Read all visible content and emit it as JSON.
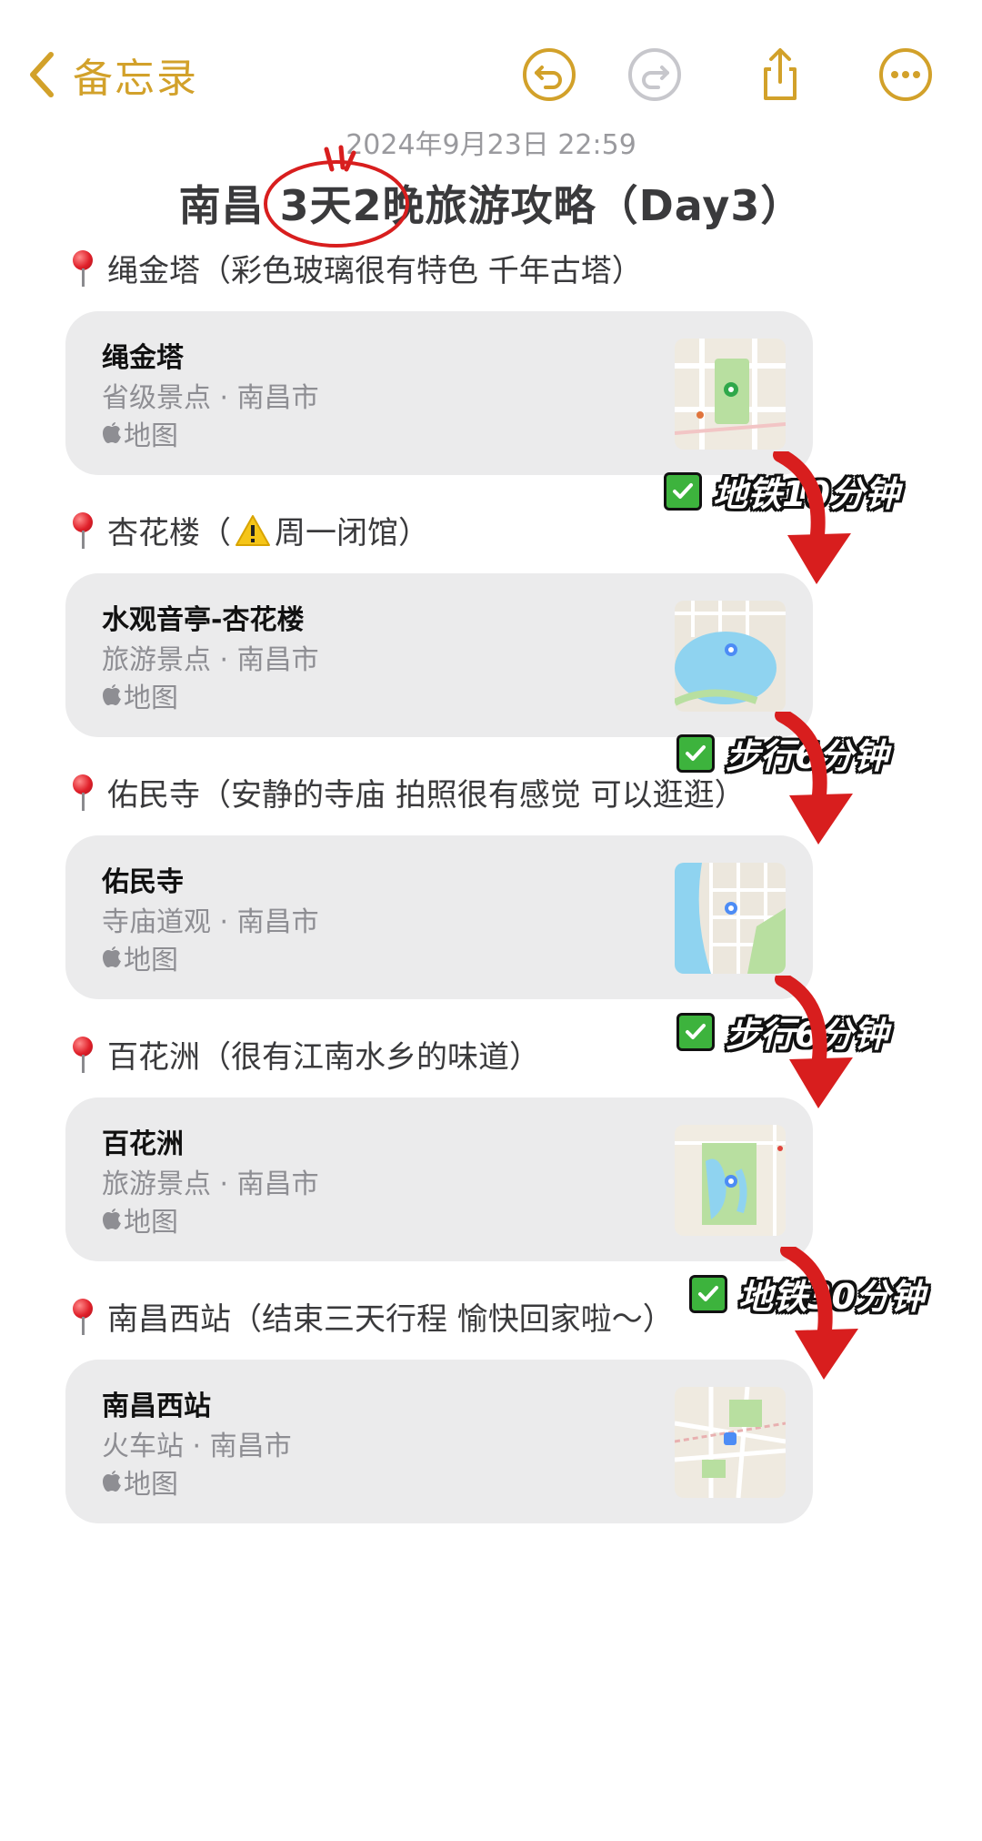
{
  "nav": {
    "back_label": "备忘录",
    "undo_icon": "undo-icon",
    "redo_icon": "redo-icon",
    "share_icon": "share-icon",
    "more_icon": "more-icon",
    "accent_color": "#d2a12a"
  },
  "note": {
    "date": "2024年9月23日 22:59",
    "title": "南昌 3天2晚旅游攻略（Day3）"
  },
  "sections": [
    {
      "heading": "绳金塔（彩色玻璃很有特色 千年古塔）",
      "card": {
        "name": "绳金塔",
        "subtitle": "省级景点 · 南昌市",
        "source": "地图"
      }
    },
    {
      "heading_before": "杏花楼（",
      "heading_after": "周一闭馆）",
      "card": {
        "name": "水观音亭-杏花楼",
        "subtitle": "旅游景点 · 南昌市",
        "source": "地图"
      }
    },
    {
      "heading": "佑民寺（安静的寺庙 拍照很有感觉 可以逛逛）",
      "card": {
        "name": "佑民寺",
        "subtitle": "寺庙道观 · 南昌市",
        "source": "地图"
      }
    },
    {
      "heading": "百花洲（很有江南水乡的味道）",
      "card": {
        "name": "百花洲",
        "subtitle": "旅游景点 · 南昌市",
        "source": "地图"
      }
    },
    {
      "heading": "南昌西站（结束三天行程 愉快回家啦～）",
      "card": {
        "name": "南昌西站",
        "subtitle": "火车站 · 南昌市",
        "source": "地图"
      }
    }
  ],
  "transits": [
    "地铁10分钟",
    "步行6分钟",
    "步行6分钟",
    "地铁30分钟"
  ],
  "colors": {
    "card_bg": "#ebebec",
    "annotation_red": "#d81e1e",
    "check_green": "#3db33d"
  }
}
